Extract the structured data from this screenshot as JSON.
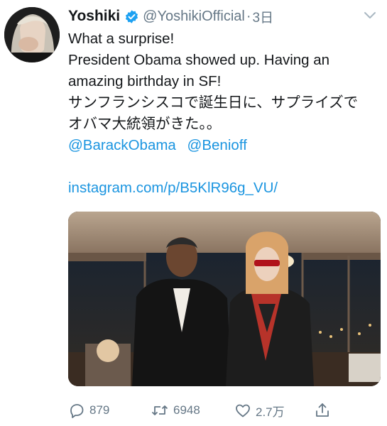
{
  "tweet": {
    "display_name": "Yoshiki",
    "handle": "@YoshikiOfficial",
    "separator": "·",
    "time": "3日",
    "lines": [
      "What a surprise!",
      "President Obama showed up. Having an",
      "amazing birthday in SF!",
      "サンフランシスコで誕生日に、サプライズで",
      "オバマ大統領がきた。。"
    ],
    "mentions": [
      "@BarackObama",
      "@Benioff"
    ],
    "url": "instagram.com/p/B5KlR96g_VU/"
  },
  "actions": {
    "reply_count": "879",
    "retweet_count": "6948",
    "like_count": "2.7万"
  },
  "colors": {
    "link": "#1b95e0",
    "verified": "#1da1f2",
    "secondary_text": "#657786"
  },
  "icons": {
    "verified": "verified-badge-icon",
    "chevron": "chevron-down-icon",
    "reply": "reply-icon",
    "retweet": "retweet-icon",
    "like": "heart-icon",
    "share": "share-icon"
  }
}
